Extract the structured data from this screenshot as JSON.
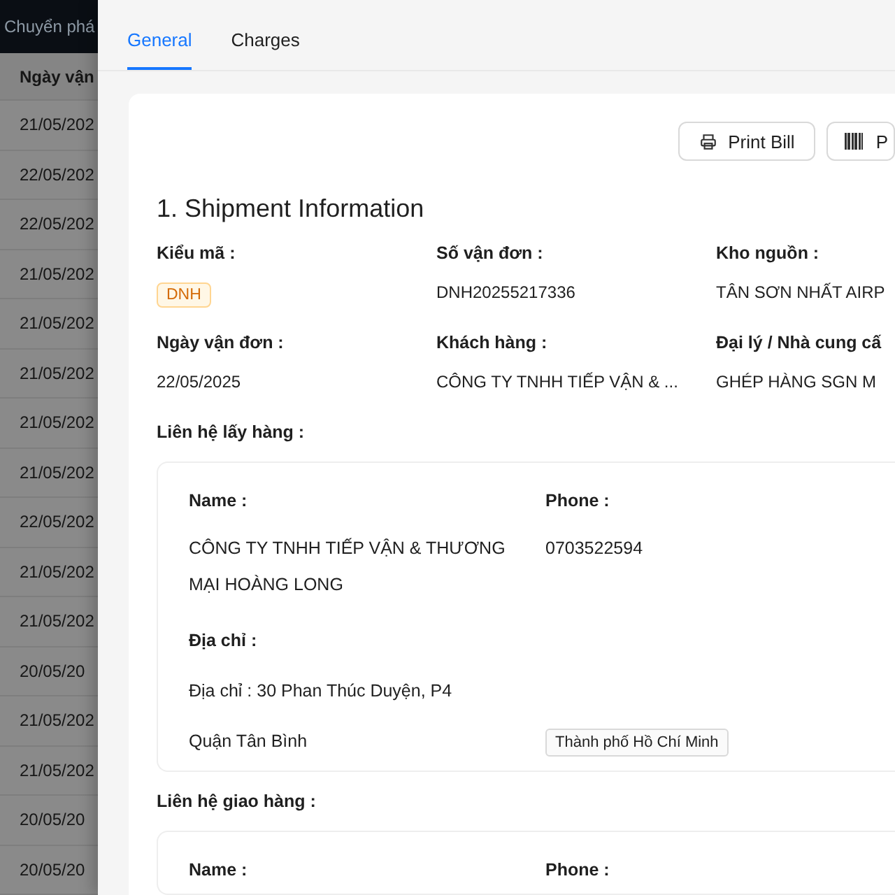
{
  "background_table": {
    "header_title": "Chuyển phá",
    "column_header": "Ngày vận",
    "rows": [
      "21/05/202",
      "22/05/202",
      "22/05/202",
      "21/05/202",
      "21/05/202",
      "21/05/202",
      "21/05/202",
      "21/05/202",
      "22/05/202",
      "21/05/202",
      "21/05/202",
      "20/05/20",
      "21/05/202",
      "21/05/202",
      "20/05/20",
      "20/05/20"
    ]
  },
  "drawer": {
    "tabs": [
      {
        "label": "General",
        "selected": true
      },
      {
        "label": "Charges",
        "selected": false
      }
    ],
    "buttons": [
      {
        "kind": "print",
        "label": "Print Bill"
      },
      {
        "kind": "barcode",
        "label": "P"
      }
    ],
    "section_title": "1. Shipment Information",
    "fields": [
      {
        "label": "Kiểu mã :",
        "value": "DNH",
        "kind": "tag"
      },
      {
        "label": "Số vận đơn :",
        "value": "DNH20255217336",
        "kind": "text"
      },
      {
        "label": "Kho nguồn :",
        "value": "TÂN SƠN NHẤT AIRP",
        "kind": "text"
      },
      {
        "label": "Ngày vận đơn :",
        "value": "22/05/2025",
        "kind": "text"
      },
      {
        "label": "Khách hàng :",
        "value": "CÔNG TY TNHH TIẾP VẬN & ...",
        "kind": "text"
      },
      {
        "label": "Đại lý / Nhà cung cấ",
        "value": "GHÉP HÀNG SGN M",
        "kind": "text"
      }
    ],
    "pickup": {
      "title": "Liên hệ lấy hàng :",
      "name_label": "Name :",
      "name": "CÔNG TY TNHH TIẾP VẬN & THƯƠNG MẠI HOÀNG LONG",
      "phone_label": "Phone :",
      "phone": "0703522594",
      "address_label": "Địa chỉ :",
      "address_line": "Địa chỉ : 30 Phan Thúc Duyện, P4",
      "district": "Quận Tân Bình",
      "city": "Thành phố Hồ Chí Minh"
    },
    "delivery": {
      "title": "Liên hệ giao hàng :",
      "name_label": "Name :",
      "phone_label": "Phone :"
    }
  }
}
